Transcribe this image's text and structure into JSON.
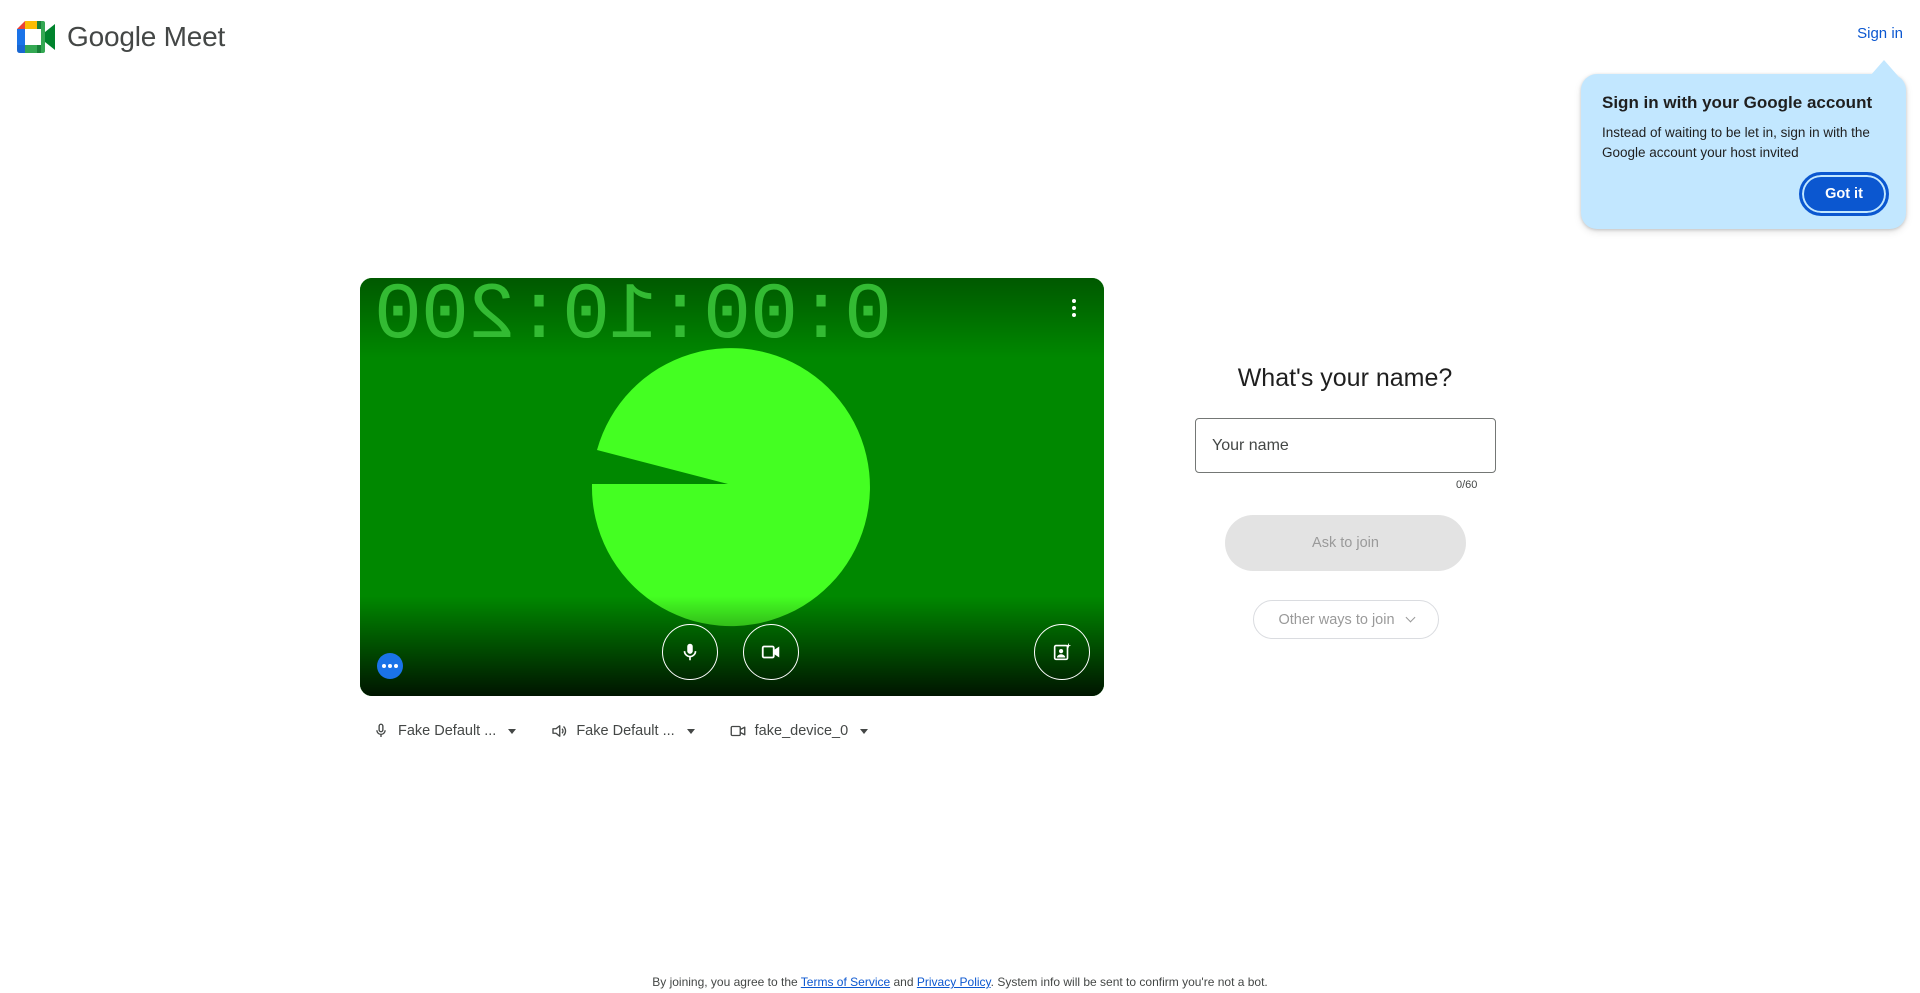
{
  "header": {
    "app_name": "Google Meet",
    "sign_in_label": "Sign in"
  },
  "tooltip": {
    "title": "Sign in with your Google account",
    "body": "Instead of waiting to be let in, sign in with the Google account your host invited",
    "button_label": "Got it"
  },
  "preview": {
    "timer_text": "0:00:10:200",
    "colors": {
      "background": "#008800",
      "pacman": "#44ff22"
    }
  },
  "devices": {
    "microphone": "Fake Default ...",
    "speaker": "Fake Default ...",
    "camera": "fake_device_0"
  },
  "join": {
    "title": "What's your name?",
    "name_placeholder": "Your name",
    "name_value": "",
    "char_counter": "0/60",
    "ask_to_join_label": "Ask to join",
    "other_ways_label": "Other ways to join"
  },
  "footer": {
    "prefix": "By joining, you agree to the",
    "terms_link": "Terms of Service",
    "and": "and",
    "privacy_link": "Privacy Policy",
    "suffix": ". System info will be sent to confirm you're not a bot."
  },
  "colors": {
    "accent": "#0b57d0",
    "tooltip_bg": "#c2e7ff",
    "disabled_button": "#e3e3e3"
  },
  "icons": {
    "logo": "google-meet-logo-icon",
    "mic": "microphone-icon",
    "camera": "video-camera-icon",
    "speaker": "speaker-icon",
    "effects": "visual-effects-icon",
    "more": "more-options-icon"
  }
}
